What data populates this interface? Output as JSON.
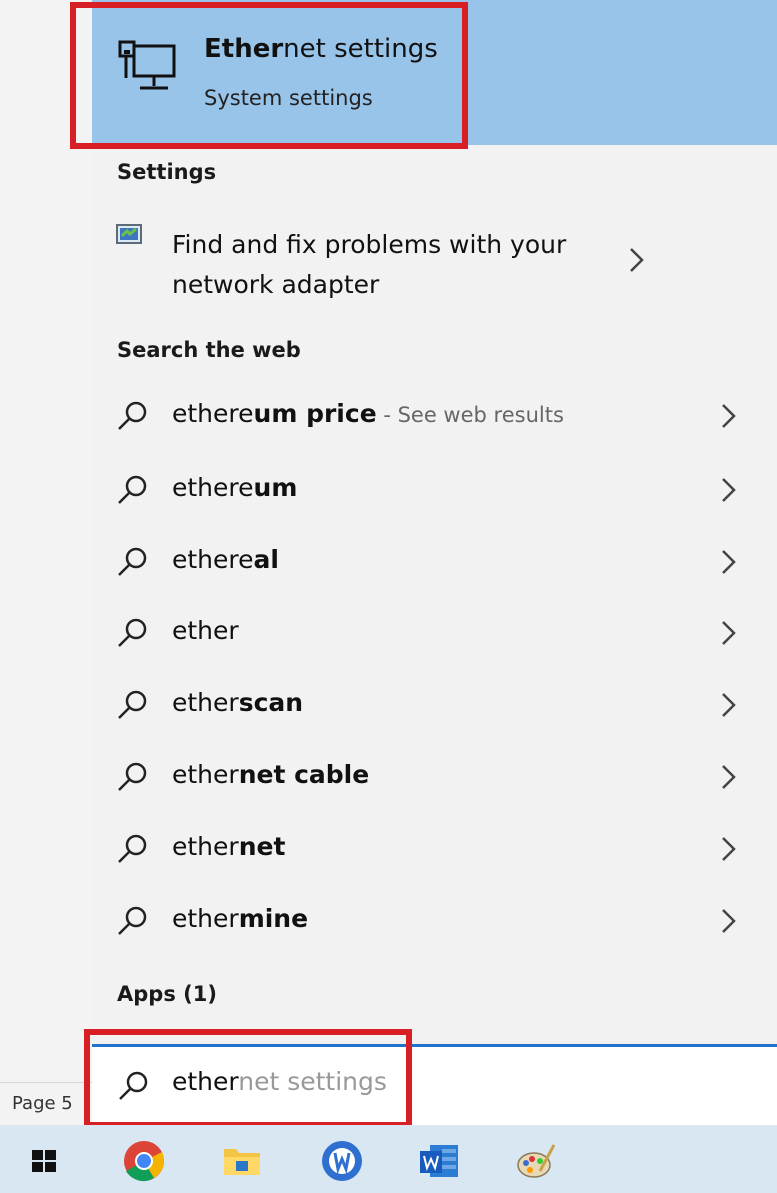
{
  "best_match": {
    "title_bold": "Ether",
    "title_rest": "net settings",
    "subtitle": "System settings",
    "icon": "ethernet-monitor-icon"
  },
  "sections": {
    "settings": "Settings",
    "search_web": "Search the web",
    "apps": "Apps (1)"
  },
  "settings_item": {
    "line1": "Find and fix problems with your",
    "line2": "network adapter",
    "icon": "network-troubleshoot-icon"
  },
  "web_results": [
    {
      "typed": "ethere",
      "bold": "um price",
      "hint": " - See web results"
    },
    {
      "typed": "ethere",
      "bold": "um"
    },
    {
      "typed": "ethere",
      "bold": "al"
    },
    {
      "typed": "ether",
      "bold": ""
    },
    {
      "typed": "ether",
      "bold": "scan"
    },
    {
      "typed": "ether",
      "bold": "net cable"
    },
    {
      "typed": "ether",
      "bold": "net"
    },
    {
      "typed": "ether",
      "bold": "mine"
    }
  ],
  "search": {
    "typed": "ether",
    "suggestion": "net settings"
  },
  "status": {
    "page": "Page 5"
  },
  "taskbar": [
    "windows-start-icon",
    "chrome-icon",
    "file-explorer-icon",
    "rounded-app-icon",
    "word-icon",
    "paint-icon"
  ],
  "colors": {
    "highlight": "#99c4ea",
    "annotation_red": "#d91f26",
    "search_accent": "#1f73c8"
  }
}
